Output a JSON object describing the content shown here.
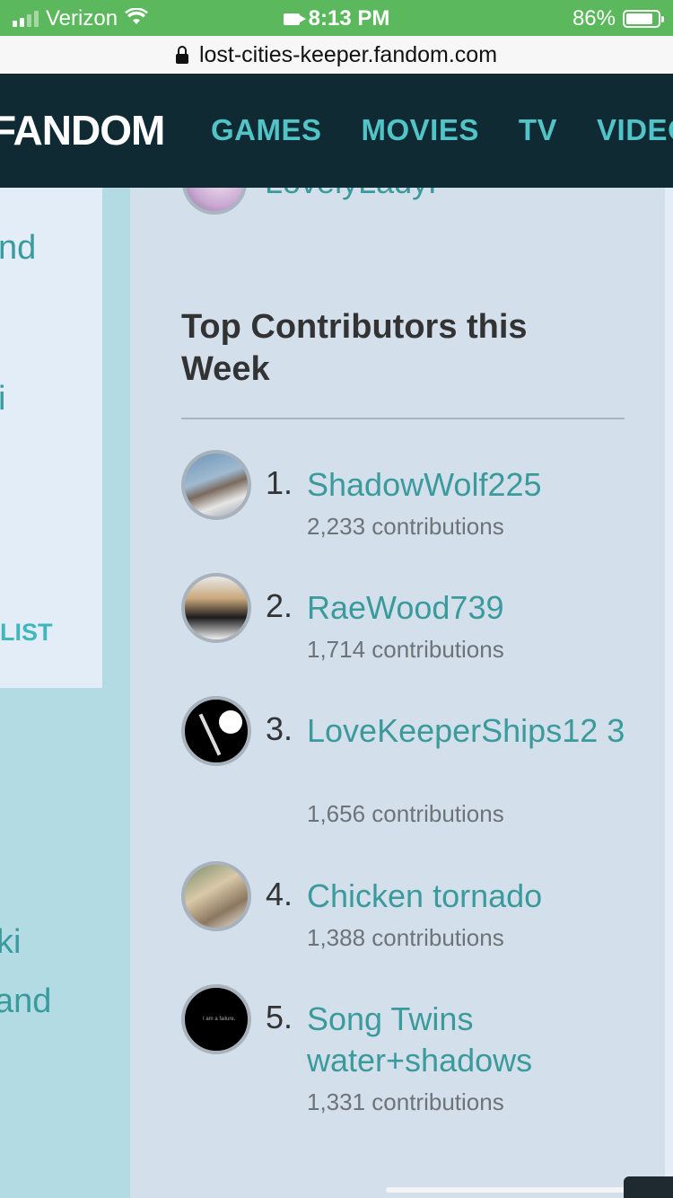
{
  "status_bar": {
    "carrier": "Verizon",
    "time": "8:13 PM",
    "battery": "86%",
    "battery_level": 0.86
  },
  "url_bar": {
    "url": "lost-cities-keeper.fandom.com"
  },
  "nav": {
    "logo": "FANDOM",
    "items": [
      "GAMES",
      "MOVIES",
      "TV",
      "VIDEO"
    ]
  },
  "left_panel": {
    "text_1": "nd",
    "text_2": "i",
    "list_label": "LIST",
    "text_3": "ki",
    "text_4": "and"
  },
  "previous_user": {
    "name": "LovelyLadyF"
  },
  "top_contributors": {
    "title": "Top Contributors this Week",
    "items": [
      {
        "rank": "1.",
        "name": "ShadowWolf225",
        "count": "2,233 contributions"
      },
      {
        "rank": "2.",
        "name": "RaeWood739",
        "count": "1,714 contributions"
      },
      {
        "rank": "3.",
        "name": "LoveKeeperShips12 3",
        "count": "1,656 contributions"
      },
      {
        "rank": "4.",
        "name": "Chicken tornado",
        "count": "1,388 contributions"
      },
      {
        "rank": "5.",
        "name": "Song Twins water+shadows",
        "count": "1,331 contributions"
      }
    ]
  },
  "avatar_5_caption": "I am a failure."
}
